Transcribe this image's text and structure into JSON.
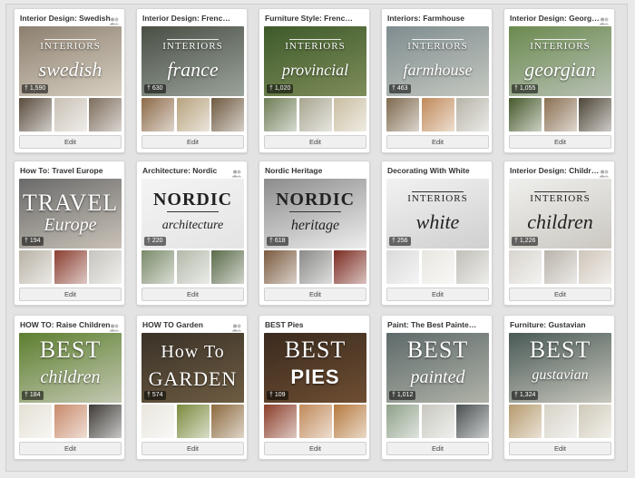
{
  "boards": [
    {
      "title": "Interior Design: Swedish",
      "count": "1,590",
      "collab": true,
      "style": "a",
      "top": "INTERIORS",
      "bot": "swedish",
      "c": [
        "#8c7f6f",
        "#d8d0c2"
      ],
      "t": [
        "#5a4c3e",
        "#c8c0b4",
        "#7d6d5c"
      ],
      "dark": false
    },
    {
      "title": "Interior Design: French Style",
      "count": "630",
      "collab": false,
      "style": "a",
      "top": "INTERIORS",
      "bot": "france",
      "c": [
        "#4a4f45",
        "#9aa39a"
      ],
      "t": [
        "#8c6a48",
        "#b7a27e",
        "#6e5a40"
      ],
      "dark": false
    },
    {
      "title": "Furniture Style: French Provinc...",
      "count": "1,020",
      "collab": false,
      "style": "a",
      "top": "INTERIORS",
      "bot": "provincial",
      "c": [
        "#3e5a2a",
        "#7e8d5a"
      ],
      "t": [
        "#6f7d57",
        "#a8a590",
        "#c9bda0"
      ],
      "dark": false
    },
    {
      "title": "Interiors: Farmhouse",
      "count": "463",
      "collab": false,
      "style": "a",
      "top": "INTERIORS",
      "bot": "farmhouse",
      "c": [
        "#7f8c8f",
        "#c4c8c0"
      ],
      "t": [
        "#7e6a4e",
        "#c08a5a",
        "#b7b4a8"
      ],
      "dark": false
    },
    {
      "title": "Interior Design: Georgian & ...",
      "count": "1,055",
      "collab": true,
      "style": "a",
      "top": "INTERIORS",
      "bot": "georgian",
      "c": [
        "#6b8a4e",
        "#b8c1b5"
      ],
      "t": [
        "#46592b",
        "#8a6f52",
        "#4e4638"
      ],
      "dark": false
    },
    {
      "title": "How To: Travel Europe",
      "count": "194",
      "collab": false,
      "style": "b",
      "top": "TRAVEL",
      "bot": "Europe",
      "c": [
        "#6a6a6a",
        "#c9c2b8"
      ],
      "t": [
        "#b8b2a5",
        "#8a3e30",
        "#c6c4bd"
      ],
      "dark": false
    },
    {
      "title": "Architecture: Nordic",
      "count": "220",
      "collab": true,
      "style": "c",
      "top": "NORDIC",
      "bot": "architecture",
      "c": [
        "#f4f4f4",
        "#e4e4e4"
      ],
      "t": [
        "#7a8a6a",
        "#b4b9aa",
        "#5a6b4a"
      ],
      "dark": true
    },
    {
      "title": "Nordic Heritage",
      "count": "618",
      "collab": false,
      "style": "c",
      "top": "NORDIC",
      "bot": "heritage",
      "c": [
        "#8c8c8c",
        "#ededed"
      ],
      "t": [
        "#7a5a3e",
        "#8a8a88",
        "#7a2a20"
      ],
      "dark": true
    },
    {
      "title": "Decorating With White",
      "count": "256",
      "collab": false,
      "style": "a",
      "top": "INTERIORS",
      "bot": "white",
      "c": [
        "#f2f2f2",
        "#cfcfcf"
      ],
      "t": [
        "#dadada",
        "#e8e6e0",
        "#c0bfb8"
      ],
      "dark": true
    },
    {
      "title": "Interior Design: Childrens R...",
      "count": "1,226",
      "collab": true,
      "style": "a",
      "top": "INTERIORS",
      "bot": "children",
      "c": [
        "#efefed",
        "#cbc8c1"
      ],
      "t": [
        "#d8d4ce",
        "#b9b3aa",
        "#cfc6ba"
      ],
      "dark": true
    },
    {
      "title": "HOW TO: Raise Children",
      "count": "184",
      "collab": true,
      "style": "d",
      "top": "BEST",
      "bot": "children",
      "c": [
        "#5d7f2f",
        "#c3c8b2"
      ],
      "t": [
        "#e4e0d4",
        "#c88a6a",
        "#3e3a36"
      ],
      "dark": false
    },
    {
      "title": "HOW TO Garden",
      "count": "574",
      "collab": true,
      "style": "e",
      "top": "How To",
      "bot": "GARDEN",
      "c": [
        "#3a3228",
        "#6e5c42"
      ],
      "t": [
        "#e9e6de",
        "#7a8a3e",
        "#8c6a3e"
      ],
      "dark": false
    },
    {
      "title": "BEST Pies",
      "count": "109",
      "collab": false,
      "style": "f",
      "top": "BEST",
      "bot": "PIES",
      "c": [
        "#3a2a1e",
        "#6e4e32"
      ],
      "t": [
        "#8a3e2a",
        "#c08a5a",
        "#b57a3e"
      ],
      "dark": false
    },
    {
      "title": "Paint: The Best Painted Furn...",
      "count": "1,012",
      "collab": false,
      "style": "d",
      "top": "BEST",
      "bot": "painted",
      "c": [
        "#5e6a6a",
        "#b0b3a8"
      ],
      "t": [
        "#8fa08a",
        "#c8c8c0",
        "#4a5050"
      ],
      "dark": false
    },
    {
      "title": "Furniture: Gustavian",
      "count": "1,324",
      "collab": false,
      "style": "d",
      "top": "BEST",
      "bot": "gustavian",
      "c": [
        "#4a5a56",
        "#c7c7bd"
      ],
      "t": [
        "#b59a6e",
        "#d6d2c7",
        "#cfc9b8"
      ],
      "dark": false
    }
  ],
  "edit_label": "Edit"
}
